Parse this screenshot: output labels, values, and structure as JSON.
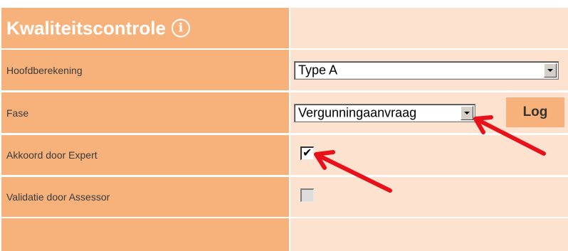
{
  "panel": {
    "title": "Kwaliteitscontrole",
    "info_icon": "info-icon",
    "info_glyph": "i"
  },
  "rows": [
    {
      "label": "Hoofdberekening",
      "value": "Type A",
      "control": "select"
    },
    {
      "label": "Fase",
      "value": "Vergunningaanvraag",
      "control": "select"
    },
    {
      "label": "Akkoord door Expert",
      "checked": true,
      "enabled": true,
      "control": "checkbox"
    },
    {
      "label": "Validatie door Assessor",
      "checked": false,
      "enabled": false,
      "control": "checkbox"
    }
  ],
  "log_button": {
    "label": "Log"
  },
  "check_glyph": "✔",
  "colors": {
    "label_bg": "#f7b27b",
    "value_bg": "#fde3cf",
    "annotation_arrow": "#e8101a"
  }
}
